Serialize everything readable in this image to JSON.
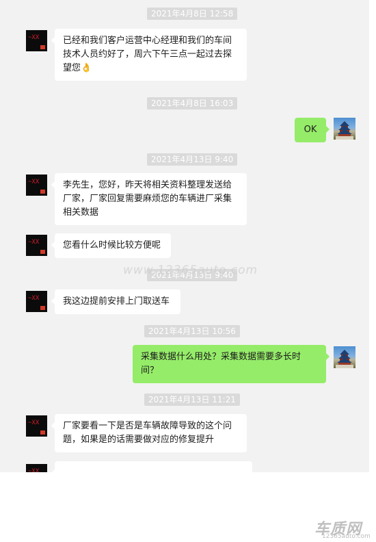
{
  "chat": {
    "timestamps": [
      "2021年4月8日 12:58",
      "2021年4月8日 16:03",
      "2021年4月13日 9:40",
      "2021年4月13日 9:40",
      "2021年4月13日 10:56",
      "2021年4月13日 11:21"
    ],
    "messages": [
      {
        "side": "left",
        "text": "已经和我们客户运营中心经理和我们的车间技术人员约好了，周六下午三点一起过去探望您",
        "emoji": "👌"
      },
      {
        "side": "right",
        "text": "OK"
      },
      {
        "side": "left",
        "text": "李先生，您好，昨天将相关资料整理发送给厂家，厂家回复需要麻烦您的车辆进厂采集相关数据"
      },
      {
        "side": "left",
        "text": "您看什么时候比较方便呢"
      },
      {
        "side": "left",
        "text": "我这边提前安排上门取送车"
      },
      {
        "side": "right",
        "text": "采集数据什么用处？采集数据需要多长时间？"
      },
      {
        "side": "left",
        "text": "厂家要看一下是否是车辆故障导致的这个问题，如果是的话需要做对应的修复提升"
      }
    ],
    "left_avatar": {
      "text": "~XX"
    },
    "right_avatar": {
      "icon": "temple-of-heaven-icon"
    }
  },
  "watermarks": {
    "middle": "www.12365auto.com",
    "logo": "车质网",
    "url": "12365auto.com"
  },
  "colors": {
    "incoming_bubble": "#ffffff",
    "outgoing_bubble": "#95ec69",
    "background": "#f2f2f2",
    "timestamp_bg": "#dadada"
  }
}
